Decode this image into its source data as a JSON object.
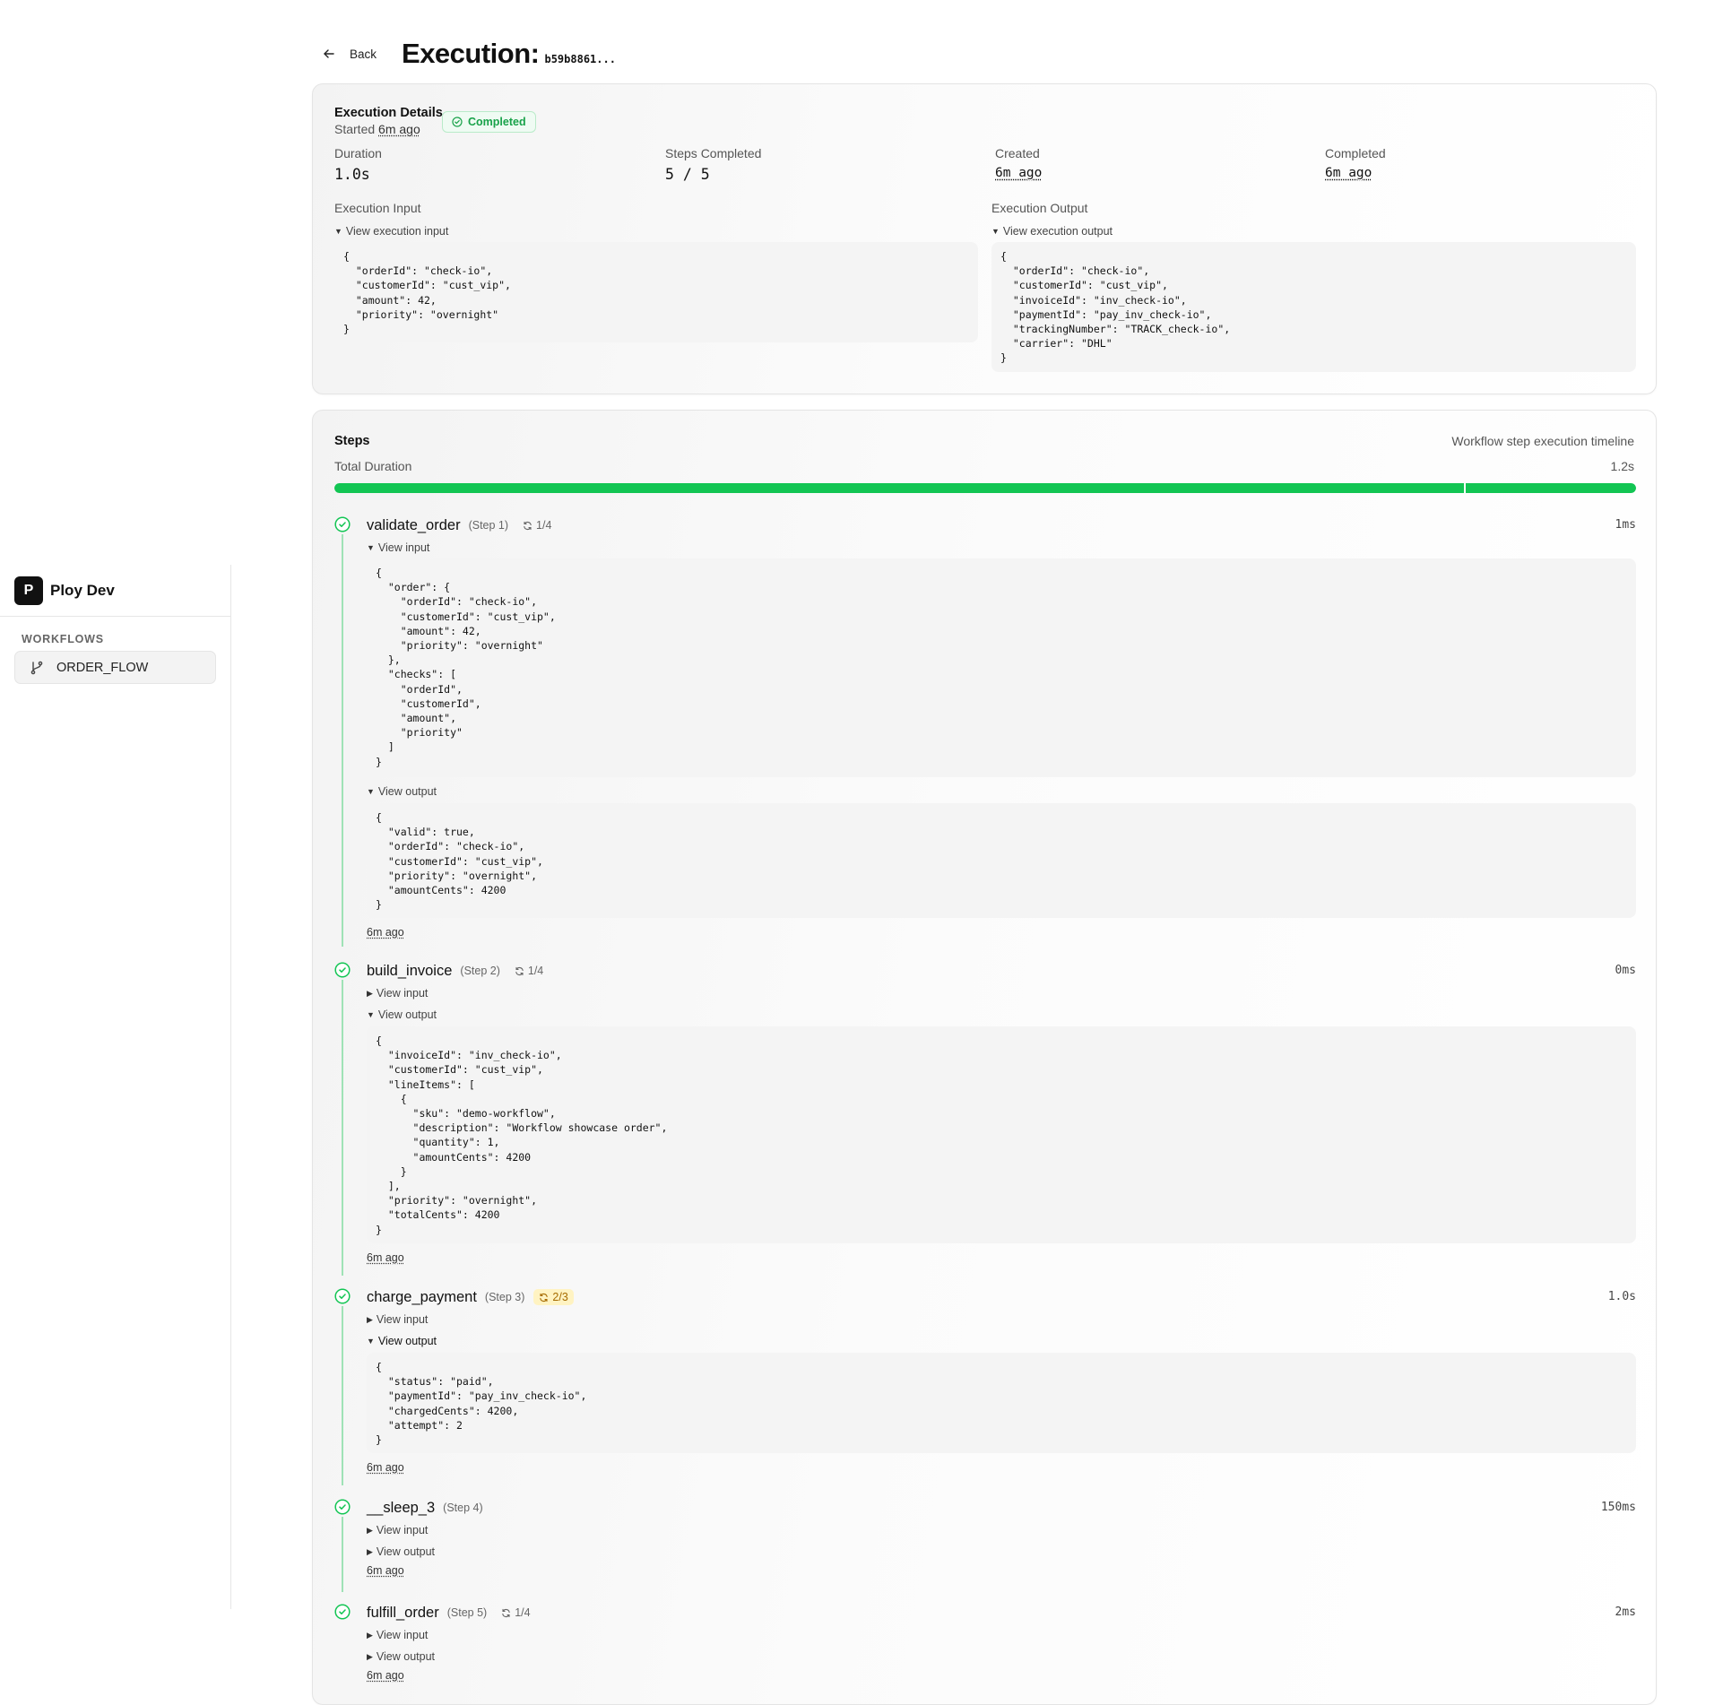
{
  "sidebar": {
    "logo_letter": "P",
    "brand": "Ploy Dev",
    "section": "WORKFLOWS",
    "items": [
      {
        "label": "ORDER_FLOW",
        "icon": "git-branch-icon"
      }
    ]
  },
  "header": {
    "back_label": "Back",
    "title": "Execution:",
    "execution_id": "b59b8861..."
  },
  "details": {
    "title": "Execution Details",
    "started_prefix": "Started",
    "started_ago": "6m ago",
    "status": "Completed",
    "stats": [
      {
        "label": "Duration",
        "value": "1.0s"
      },
      {
        "label": "Steps Completed",
        "value": "5 / 5"
      },
      {
        "label": "Created",
        "value": "6m ago"
      },
      {
        "label": "Completed",
        "value": "6m ago"
      }
    ],
    "input": {
      "label": "Execution Input",
      "toggle": "View execution input",
      "code": "{\n  \"orderId\": \"check-io\",\n  \"customerId\": \"cust_vip\",\n  \"amount\": 42,\n  \"priority\": \"overnight\"\n}"
    },
    "output": {
      "label": "Execution Output",
      "toggle": "View execution output",
      "code": "{\n  \"orderId\": \"check-io\",\n  \"customerId\": \"cust_vip\",\n  \"invoiceId\": \"inv_check-io\",\n  \"paymentId\": \"pay_inv_check-io\",\n  \"trackingNumber\": \"TRACK_check-io\",\n  \"carrier\": \"DHL\"\n}"
    }
  },
  "steps_section": {
    "title": "Steps",
    "subtitle": "Workflow step execution timeline",
    "total_label": "Total Duration",
    "total_value": "1.2s",
    "progress": 1.0
  },
  "steps": [
    {
      "name": "validate_order",
      "number": "(Step 1)",
      "attempts": "1/4",
      "duration": "1ms",
      "input_toggle": "View input",
      "output_toggle": "View output",
      "input_code": "{\n  \"order\": {\n    \"orderId\": \"check-io\",\n    \"customerId\": \"cust_vip\",\n    \"amount\": 42,\n    \"priority\": \"overnight\"\n  },\n  \"checks\": [\n    \"orderId\",\n    \"customerId\",\n    \"amount\",\n    \"priority\"\n  ]\n}",
      "output_code": "{\n  \"valid\": true,\n  \"orderId\": \"check-io\",\n  \"customerId\": \"cust_vip\",\n  \"priority\": \"overnight\",\n  \"amountCents\": 4200\n}",
      "time": "6m ago"
    },
    {
      "name": "build_invoice",
      "number": "(Step 2)",
      "attempts": "1/4",
      "duration": "0ms",
      "input_toggle": "View input",
      "output_toggle": "View output",
      "output_code": "{\n  \"invoiceId\": \"inv_check-io\",\n  \"customerId\": \"cust_vip\",\n  \"lineItems\": [\n    {\n      \"sku\": \"demo-workflow\",\n      \"description\": \"Workflow showcase order\",\n      \"quantity\": 1,\n      \"amountCents\": 4200\n    }\n  ],\n  \"priority\": \"overnight\",\n  \"totalCents\": 4200\n}",
      "time": "6m ago"
    },
    {
      "name": "charge_payment",
      "number": "(Step 3)",
      "attempts": "2/3",
      "duration": "1.0s",
      "input_toggle": "View input",
      "output_toggle": "View output",
      "output_code": "{\n  \"status\": \"paid\",\n  \"paymentId\": \"pay_inv_check-io\",\n  \"chargedCents\": 4200,\n  \"attempt\": 2\n}",
      "time": "6m ago"
    },
    {
      "name": "__sleep_3",
      "number": "(Step 4)",
      "duration": "150ms",
      "input_toggle": "View input",
      "output_toggle": "View output",
      "time": "6m ago"
    },
    {
      "name": "fulfill_order",
      "number": "(Step 5)",
      "attempts": "1/4",
      "duration": "2ms",
      "input_toggle": "View input",
      "output_toggle": "View output",
      "time": "6m ago"
    }
  ],
  "colors": {
    "success": "#12c553",
    "warning_bg": "#fff3c2",
    "code_bg": "#f4f4f4"
  }
}
